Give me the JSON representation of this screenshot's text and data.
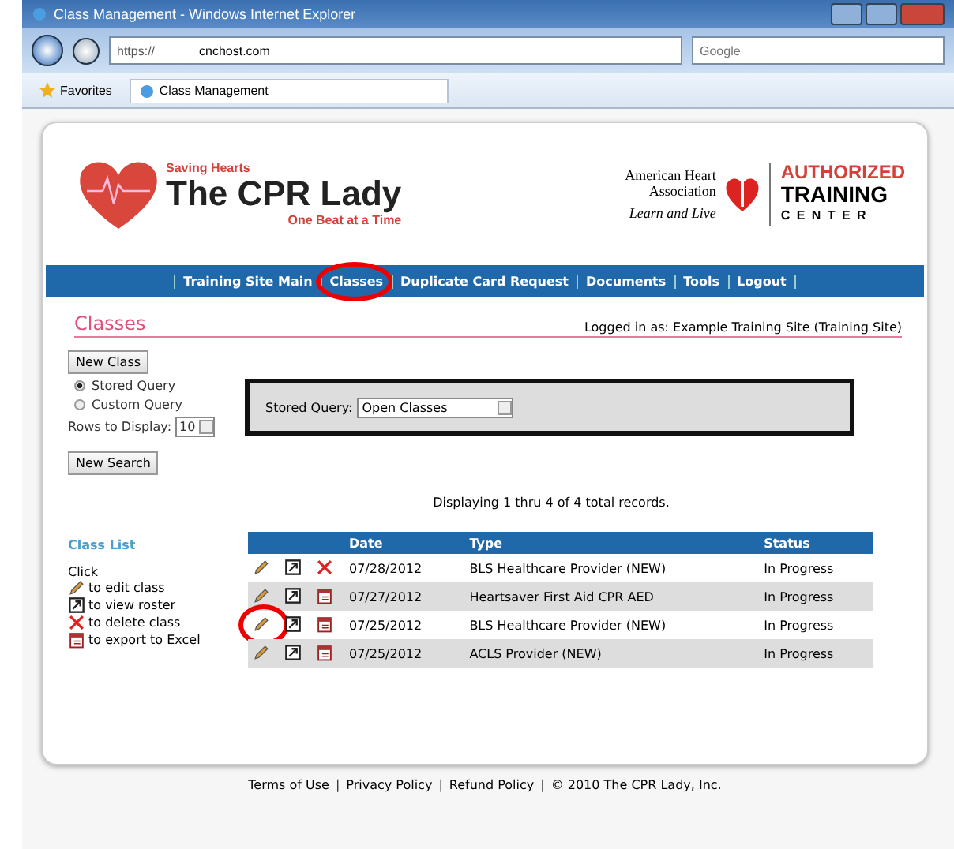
{
  "window": {
    "title": "Class Management - Windows Internet Explorer"
  },
  "address_bar": {
    "scheme": "https://",
    "host": "cnchost.com"
  },
  "search_box": {
    "placeholder": "Google"
  },
  "favorites": {
    "label": "Favorites"
  },
  "tab": {
    "label": "Class Management"
  },
  "logo": {
    "tagline_top": "Saving Hearts",
    "name": "The CPR Lady",
    "tagline_bottom": "One Beat at a Time"
  },
  "partner": {
    "org_line1": "American Heart",
    "org_line2": "Association",
    "motto": "Learn and Live",
    "badge_line1": "AUTHORIZED",
    "badge_line2": "TRAINING",
    "badge_line3": "C E N T E R"
  },
  "nav": [
    {
      "label": "Training Site Main",
      "circled": false
    },
    {
      "label": "Classes",
      "circled": true
    },
    {
      "label": "Duplicate Card Request",
      "circled": false
    },
    {
      "label": "Documents",
      "circled": false
    },
    {
      "label": "Tools",
      "circled": false
    },
    {
      "label": "Logout",
      "circled": false
    }
  ],
  "page_title": "Classes",
  "logged_in": "Logged in as: Example Training Site (Training Site)",
  "new_class_button": "New Class",
  "query_modes": [
    {
      "label": "Stored Query",
      "selected": true
    },
    {
      "label": "Custom Query",
      "selected": false
    }
  ],
  "rows_to_display": {
    "label": "Rows to Display:",
    "value": "10"
  },
  "new_search_button": "New Search",
  "stored_query": {
    "label": "Stored Query:",
    "value": "Open Classes"
  },
  "records_summary": "Displaying 1 thru 4 of 4 total records.",
  "legend": {
    "title": "Class List",
    "intro": "Click",
    "items": [
      {
        "kind": "edit",
        "label": "to edit class"
      },
      {
        "kind": "roster",
        "label": "to view roster"
      },
      {
        "kind": "delete",
        "label": "to delete class"
      },
      {
        "kind": "export",
        "label": "to export to Excel"
      }
    ]
  },
  "table": {
    "columns": [
      "Date",
      "Type",
      "Status"
    ],
    "rows": [
      {
        "kind": "delete",
        "edit_circled": false,
        "date": "07/28/2012",
        "type": "BLS Healthcare Provider (NEW)",
        "status": "In Progress"
      },
      {
        "kind": "export",
        "edit_circled": false,
        "date": "07/27/2012",
        "type": "Heartsaver First Aid CPR AED",
        "status": "In Progress"
      },
      {
        "kind": "export",
        "edit_circled": true,
        "date": "07/25/2012",
        "type": "BLS Healthcare Provider (NEW)",
        "status": "In Progress"
      },
      {
        "kind": "export",
        "edit_circled": false,
        "date": "07/25/2012",
        "type": "ACLS Provider (NEW)",
        "status": "In Progress"
      }
    ]
  },
  "footer": [
    {
      "kind": "link",
      "text": "Terms of Use"
    },
    {
      "kind": "separator",
      "text": "|"
    },
    {
      "kind": "link",
      "text": "Privacy Policy"
    },
    {
      "kind": "separator",
      "text": "|"
    },
    {
      "kind": "link",
      "text": "Refund Policy"
    },
    {
      "kind": "separator",
      "text": "|"
    },
    {
      "kind": "copyright",
      "text": "© 2010 The CPR Lady, Inc."
    }
  ]
}
